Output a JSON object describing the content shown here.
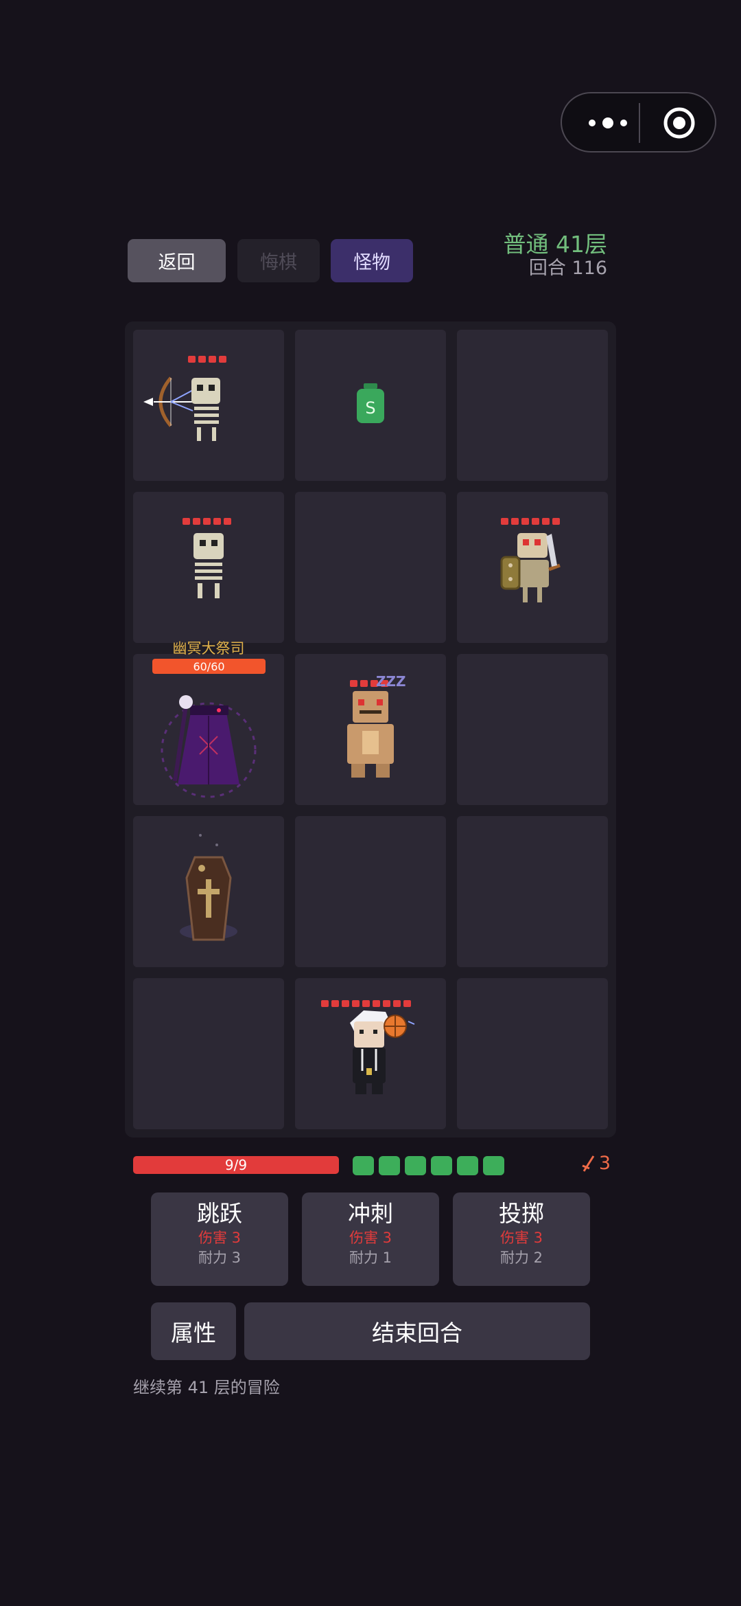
{
  "header": {
    "back_label": "返回",
    "undo_label": "悔棋",
    "monster_label": "怪物",
    "floor": "普通 41层",
    "turn": "回合 116"
  },
  "capsule": {
    "more_icon": "more-dots-icon",
    "close_icon": "target-icon"
  },
  "board": {
    "rows": 5,
    "cols": 3,
    "cells": [
      {
        "row": 0,
        "col": 0,
        "content": "skeleton-archer",
        "hp": 4
      },
      {
        "row": 0,
        "col": 1,
        "content": "green-potion-s",
        "label": "S"
      },
      {
        "row": 0,
        "col": 2,
        "content": "empty"
      },
      {
        "row": 1,
        "col": 0,
        "content": "skeleton",
        "hp": 5
      },
      {
        "row": 1,
        "col": 1,
        "content": "empty"
      },
      {
        "row": 1,
        "col": 2,
        "content": "skeleton-warrior",
        "hp": 6
      },
      {
        "row": 2,
        "col": 0,
        "content": "boss-high-priest",
        "name": "幽冥大祭司",
        "hp_text": "60/60",
        "hp_fraction": 1.0
      },
      {
        "row": 2,
        "col": 1,
        "content": "sleeping-golem",
        "hp": 4,
        "status": "zzz"
      },
      {
        "row": 2,
        "col": 2,
        "content": "empty"
      },
      {
        "row": 3,
        "col": 0,
        "content": "coffin"
      },
      {
        "row": 3,
        "col": 1,
        "content": "empty"
      },
      {
        "row": 3,
        "col": 2,
        "content": "empty"
      },
      {
        "row": 4,
        "col": 0,
        "content": "empty"
      },
      {
        "row": 4,
        "col": 1,
        "content": "player-hero",
        "hp": 9
      },
      {
        "row": 4,
        "col": 2,
        "content": "empty"
      }
    ]
  },
  "boss": {
    "name": "幽冥大祭司",
    "hp_text": "60/60"
  },
  "player": {
    "hp_text": "9/9",
    "hp_fraction": 1.0,
    "stamina_points": 6,
    "attack": "3"
  },
  "skills": [
    {
      "name": "跳跃",
      "damage": "伤害 3",
      "cost": "耐力 3"
    },
    {
      "name": "冲刺",
      "damage": "伤害 3",
      "cost": "耐力 1"
    },
    {
      "name": "投掷",
      "damage": "伤害 3",
      "cost": "耐力 2"
    }
  ],
  "actions": {
    "attributes_label": "属性",
    "end_turn_label": "结束回合"
  },
  "footer": "继续第 41 层的冒险",
  "colors": {
    "background": "#16121b",
    "cell": "#2c2834",
    "hp_red": "#e23b3b",
    "stamina_green": "#3dae5a",
    "floor_green": "#72be7d",
    "accent_purple": "#3c2f6a"
  }
}
